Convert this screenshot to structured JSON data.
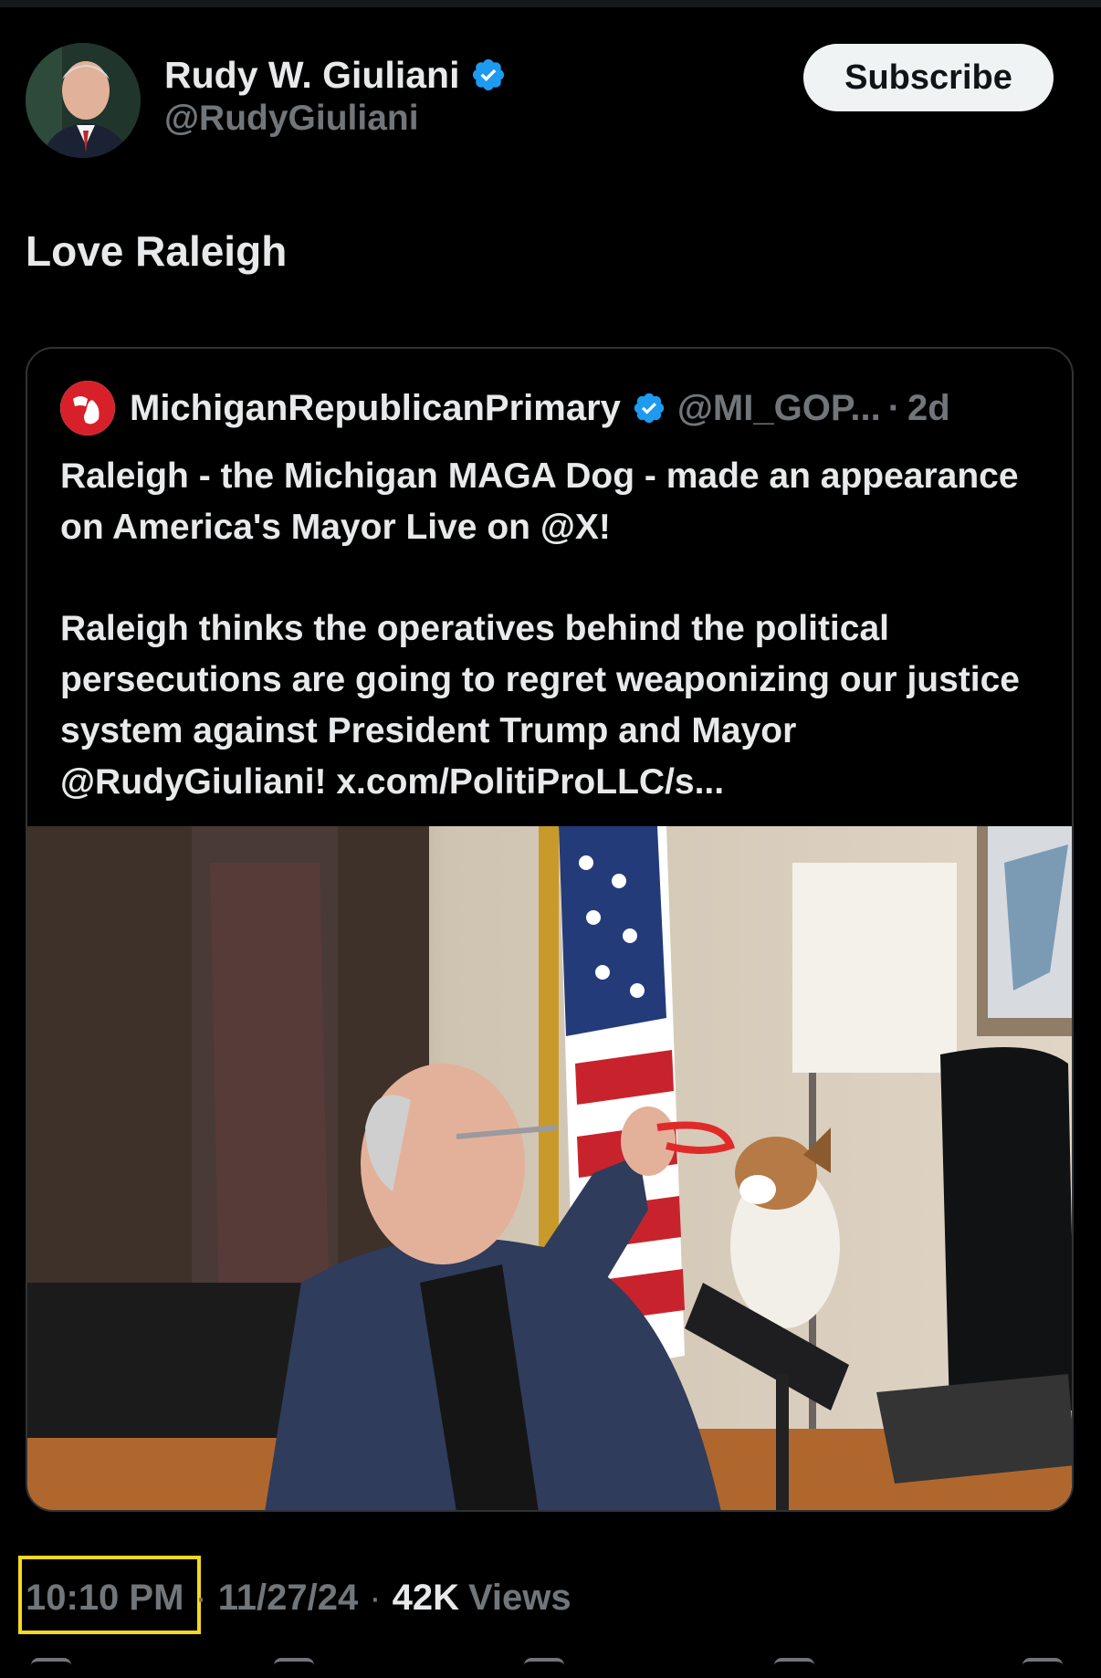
{
  "author": {
    "name": "Rudy W. Giuliani",
    "handle": "@RudyGiuliani",
    "avatar_icon": "avatar-photo-icon",
    "verified_icon": "verified-badge-icon"
  },
  "subscribe_label": "Subscribe",
  "post_text": "Love Raleigh",
  "quote": {
    "name": "MichiganRepublicanPrimary",
    "handle": "@MI_GOP...",
    "separator": "·",
    "time": "2d",
    "paragraph1": "Raleigh - the Michigan MAGA Dog - made an appearance on America's Mayor Live on @X!",
    "paragraph2": "Raleigh thinks the operatives behind the political persecutions are going to regret weaponizing our justice system against President Trump and Mayor @RudyGiuliani! x.com/PolitiProLLC/s..."
  },
  "meta": {
    "time": "10:10 PM",
    "dot1": "·",
    "date": "11/27/24",
    "dot2": "·",
    "views_count": "42K",
    "views_label": "Views"
  },
  "colors": {
    "background": "#000000",
    "text": "#e7e9ea",
    "muted": "#71767b",
    "verified": "#1d9bf0",
    "highlight": "#f5d91e"
  }
}
